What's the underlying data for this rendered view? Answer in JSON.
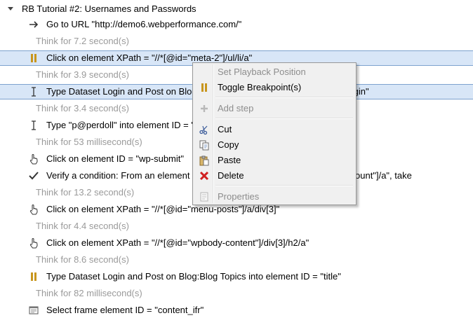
{
  "tree": {
    "root_label": "RB Tutorial #2: Usernames and Passwords",
    "rows": [
      {
        "kind": "step",
        "icon": "arrow-right-icon",
        "label": "Go to URL \"http://demo6.webperformance.com/\""
      },
      {
        "kind": "think",
        "label": "Think for 7.2 second(s)"
      },
      {
        "kind": "step",
        "icon": "breakpoint-icon",
        "label": "Click on element XPath = \"//*[@id=\"meta-2\"]/ul/li/a\"",
        "selected": true
      },
      {
        "kind": "think",
        "label": "Think for 3.9 second(s)"
      },
      {
        "kind": "step",
        "icon": "text-cursor-icon",
        "label": "Type Dataset Login and Post on Blog:Blog Topics into element ID = \"user_login\"",
        "selected": true
      },
      {
        "kind": "think",
        "label": "Think for 3.4 second(s)"
      },
      {
        "kind": "step",
        "icon": "text-cursor-icon",
        "label": "Type \"p@perdoll\" into element ID = \"user_pass\""
      },
      {
        "kind": "think",
        "label": "Think for 53 millisecond(s)"
      },
      {
        "kind": "step",
        "icon": "hand-pointer-icon",
        "label": "Click on element ID = \"wp-submit\""
      },
      {
        "kind": "step",
        "icon": "checkmark-icon",
        "label": "Verify a condition: From an element XPath = \"//*[@id=\"wp-admin-bar-my-account\"]/a\", take"
      },
      {
        "kind": "think",
        "label": "Think for 13.2 second(s)"
      },
      {
        "kind": "step",
        "icon": "hand-pointer-icon",
        "label": "Click on element XPath = \"//*[@id=\"menu-posts\"]/a/div[3]\""
      },
      {
        "kind": "think",
        "label": "Think for 4.4 second(s)"
      },
      {
        "kind": "step",
        "icon": "hand-pointer-icon",
        "label": "Click on element XPath = \"//*[@id=\"wpbody-content\"]/div[3]/h2/a\""
      },
      {
        "kind": "think",
        "label": "Think for 8.6 second(s)"
      },
      {
        "kind": "step",
        "icon": "breakpoint-icon",
        "label": "Type Dataset Login and Post on Blog:Blog Topics into element ID = \"title\""
      },
      {
        "kind": "think",
        "label": "Think for 82 millisecond(s)"
      },
      {
        "kind": "step",
        "icon": "frame-icon",
        "label": "Select frame element ID = \"content_ifr\""
      }
    ]
  },
  "context_menu": {
    "items": [
      {
        "label": "Set Playback Position",
        "icon": "",
        "disabled": true
      },
      {
        "label": "Toggle Breakpoint(s)",
        "icon": "breakpoint-icon",
        "disabled": false
      },
      {
        "label": "Add step",
        "icon": "plus-icon",
        "disabled": true
      },
      {
        "label": "Cut",
        "icon": "scissors-icon",
        "disabled": false
      },
      {
        "label": "Copy",
        "icon": "copy-icon",
        "disabled": false
      },
      {
        "label": "Paste",
        "icon": "paste-icon",
        "disabled": false
      },
      {
        "label": "Delete",
        "icon": "delete-x-icon",
        "disabled": false
      },
      {
        "label": "Properties",
        "icon": "properties-icon",
        "disabled": true
      }
    ]
  },
  "colors": {
    "selection_bg": "#d8e6f7",
    "selection_border": "#7da2ce",
    "think_text": "#9a9a9a",
    "breakpoint": "#c8961e",
    "delete_red": "#d02020"
  }
}
